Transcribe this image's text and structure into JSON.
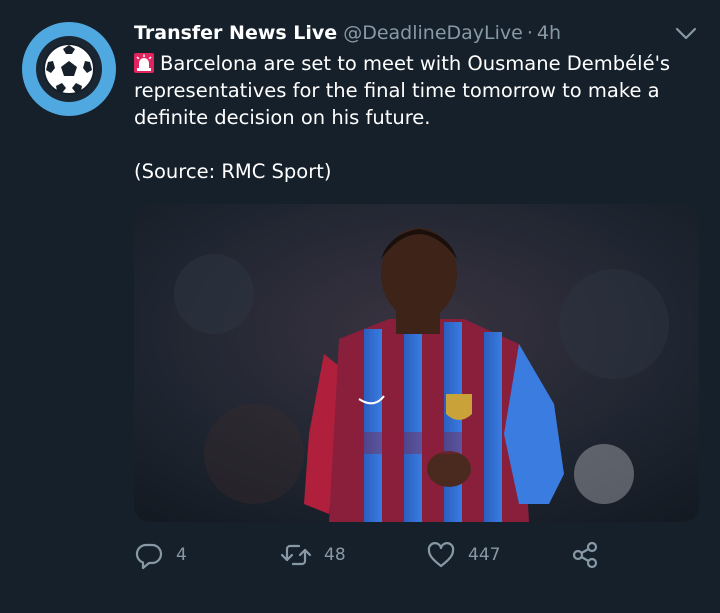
{
  "tweet": {
    "display_name": "Transfer News Live",
    "handle": "@DeadlineDayLive",
    "separator": "·",
    "time": "4h",
    "text_line1": "Barcelona are set to meet with Ousmane Dembélé's representatives for the final time tomorrow to make a definite decision on his future.",
    "source": "(Source: RMC Sport)",
    "avatar_icon": "soccer-ball-icon",
    "siren_icon": "police-light-emoji",
    "media_description_icon": "photo"
  },
  "actions": {
    "reply_count": "4",
    "retweet_count": "48",
    "like_count": "447"
  },
  "colors": {
    "background": "#15202b",
    "secondary_text": "#8899a6",
    "avatar_ring": "#4fa8e0"
  }
}
